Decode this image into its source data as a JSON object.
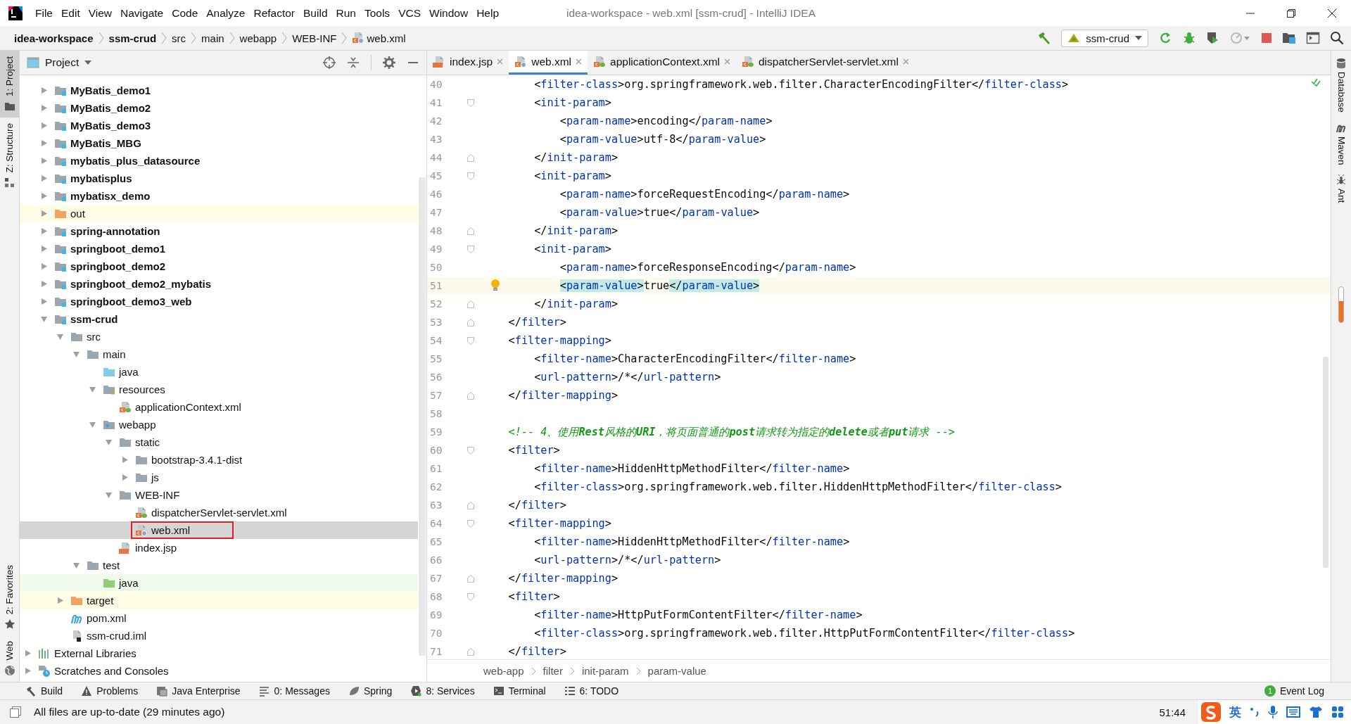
{
  "window": {
    "title": "idea-workspace - web.xml [ssm-crud] - IntelliJ IDEA"
  },
  "menu": [
    "File",
    "Edit",
    "View",
    "Navigate",
    "Code",
    "Analyze",
    "Refactor",
    "Build",
    "Run",
    "Tools",
    "VCS",
    "Window",
    "Help"
  ],
  "breadcrumbs": [
    {
      "label": "idea-workspace",
      "kind": "module"
    },
    {
      "label": "ssm-crud",
      "kind": "module"
    },
    {
      "label": "src",
      "kind": "folder"
    },
    {
      "label": "main",
      "kind": "folder"
    },
    {
      "label": "webapp",
      "kind": "folder"
    },
    {
      "label": "WEB-INF",
      "kind": "folder"
    },
    {
      "label": "web.xml",
      "kind": "file"
    }
  ],
  "run_config": {
    "label": "ssm-crud"
  },
  "left_tool_tabs": [
    {
      "label": "1: Project",
      "kind": "project",
      "selected": true
    },
    {
      "label": "Z: Structure",
      "kind": "structure",
      "selected": false
    }
  ],
  "left_tool_tabs_bottom": [
    {
      "label": "2: Favorites",
      "kind": "favorites",
      "selected": false
    },
    {
      "label": "Web",
      "kind": "web",
      "selected": false
    }
  ],
  "right_tool_tabs": [
    {
      "label": "Database",
      "kind": "database"
    },
    {
      "label": "Maven",
      "kind": "maven"
    },
    {
      "label": "Ant",
      "kind": "ant"
    }
  ],
  "project": {
    "title": "Project",
    "tree": {
      "project_items": [
        {
          "label": "MyBatis_demo1",
          "kind": "module",
          "expanded": false,
          "selected": false
        },
        {
          "label": "MyBatis_demo2",
          "kind": "module",
          "expanded": false,
          "selected": false
        },
        {
          "label": "MyBatis_demo3",
          "kind": "module",
          "expanded": false,
          "selected": false
        },
        {
          "label": "MyBatis_MBG",
          "kind": "module",
          "expanded": false,
          "selected": false
        },
        {
          "label": "mybatis_plus_datasource",
          "kind": "module",
          "expanded": false,
          "selected": false
        },
        {
          "label": "mybatisplus",
          "kind": "module",
          "expanded": false,
          "selected": false
        },
        {
          "label": "mybatisx_demo",
          "kind": "module",
          "expanded": false,
          "selected": false
        },
        {
          "label": "out",
          "kind": "excluded",
          "expanded": false,
          "selected": false
        },
        {
          "label": "spring-annotation",
          "kind": "module",
          "expanded": false,
          "selected": false
        },
        {
          "label": "springboot_demo1",
          "kind": "module",
          "expanded": false,
          "selected": false
        },
        {
          "label": "springboot_demo2",
          "kind": "module",
          "expanded": false,
          "selected": false
        },
        {
          "label": "springboot_demo2_mybatis",
          "kind": "module",
          "expanded": false,
          "selected": false
        },
        {
          "label": "springboot_demo3_web",
          "kind": "module",
          "expanded": false,
          "selected": false
        },
        {
          "label": "ssm-crud",
          "kind": "module",
          "expanded": true,
          "selected": false,
          "children": [
            {
              "label": "src",
              "kind": "folder",
              "expanded": true,
              "selected": false,
              "children": [
                {
                  "label": "main",
                  "kind": "folder",
                  "expanded": true,
                  "selected": false,
                  "children": [
                    {
                      "label": "java",
                      "kind": "source",
                      "selected": false
                    },
                    {
                      "label": "resources",
                      "kind": "resources",
                      "expanded": true,
                      "selected": false,
                      "children": [
                        {
                          "label": "applicationContext.xml",
                          "kind": "spring-xml",
                          "selected": false
                        }
                      ]
                    },
                    {
                      "label": "webapp",
                      "kind": "web",
                      "expanded": true,
                      "selected": false,
                      "children": [
                        {
                          "label": "static",
                          "kind": "folder",
                          "expanded": true,
                          "selected": false,
                          "children": [
                            {
                              "label": "bootstrap-3.4.1-dist",
                              "kind": "folder",
                              "expanded": false,
                              "selected": false
                            },
                            {
                              "label": "js",
                              "kind": "folder",
                              "expanded": false,
                              "selected": false
                            }
                          ]
                        },
                        {
                          "label": "WEB-INF",
                          "kind": "folder",
                          "expanded": true,
                          "selected": false,
                          "children": [
                            {
                              "label": "dispatcherServlet-servlet.xml",
                              "kind": "spring-xml",
                              "selected": false
                            },
                            {
                              "label": "web.xml",
                              "kind": "web-xml",
                              "selected": true
                            }
                          ]
                        },
                        {
                          "label": "index.jsp",
                          "kind": "jsp",
                          "selected": false
                        }
                      ]
                    }
                  ]
                },
                {
                  "label": "test",
                  "kind": "folder",
                  "expanded": true,
                  "selected": false,
                  "children": [
                    {
                      "label": "java",
                      "kind": "test-source",
                      "selected": false
                    }
                  ]
                }
              ]
            },
            {
              "label": "target",
              "kind": "excluded",
              "expanded": false,
              "selected": false
            },
            {
              "label": "pom.xml",
              "kind": "maven",
              "selected": false
            },
            {
              "label": "ssm-crud.iml",
              "kind": "iml",
              "selected": false
            }
          ]
        }
      ],
      "root_items": [
        {
          "label": "External Libraries",
          "kind": "libraries",
          "expanded": false,
          "selected": false
        },
        {
          "label": "Scratches and Consoles",
          "kind": "scratches",
          "expanded": false,
          "selected": false
        }
      ]
    }
  },
  "editor_tabs": [
    {
      "label": "index.jsp",
      "kind": "jsp",
      "selected": false
    },
    {
      "label": "web.xml",
      "kind": "web-xml",
      "selected": true
    },
    {
      "label": "applicationContext.xml",
      "kind": "spring-xml",
      "selected": false
    },
    {
      "label": "dispatcherServlet-servlet.xml",
      "kind": "spring-xml",
      "selected": false
    }
  ],
  "editor": {
    "lines": [
      {
        "number": "40",
        "code": "        <filter-class>org.springframework.web.filter.CharacterEncodingFilter</filter-class>"
      },
      {
        "number": "41",
        "code": "        <init-param>",
        "fold_start": true
      },
      {
        "number": "42",
        "code": "            <param-name>encoding</param-name>"
      },
      {
        "number": "43",
        "code": "            <param-value>utf-8</param-value>"
      },
      {
        "number": "44",
        "code": "        </init-param>",
        "fold_end": true
      },
      {
        "number": "45",
        "code": "        <init-param>",
        "fold_start": true
      },
      {
        "number": "46",
        "code": "            <param-name>forceRequestEncoding</param-name>"
      },
      {
        "number": "47",
        "code": "            <param-value>true</param-value>"
      },
      {
        "number": "48",
        "code": "        </init-param>",
        "fold_end": true
      },
      {
        "number": "49",
        "code": "        <init-param>",
        "fold_start": true
      },
      {
        "number": "50",
        "code": "            <param-name>forceResponseEncoding</param-name>"
      },
      {
        "number": "51",
        "code": "            <param-value>true</param-value>",
        "current": true
      },
      {
        "number": "52",
        "code": "        </init-param>",
        "fold_end": true
      },
      {
        "number": "53",
        "code": "    </filter>",
        "fold_end": true
      },
      {
        "number": "54",
        "code": "    <filter-mapping>",
        "fold_start": true
      },
      {
        "number": "55",
        "code": "        <filter-name>CharacterEncodingFilter</filter-name>"
      },
      {
        "number": "56",
        "code": "        <url-pattern>/*</url-pattern>"
      },
      {
        "number": "57",
        "code": "    </filter-mapping>",
        "fold_end": true
      },
      {
        "number": "58"
      },
      {
        "number": "59",
        "kind": "comment",
        "code": "    <!-- 4、使用**Rest**风格的**URI**，将页面普通的**post**请求转为指定的**delete**或者**put**请求 -->"
      },
      {
        "number": "60",
        "code": "    <filter>",
        "fold_start": true
      },
      {
        "number": "61",
        "code": "        <filter-name>HiddenHttpMethodFilter</filter-name>"
      },
      {
        "number": "62",
        "code": "        <filter-class>org.springframework.web.filter.HiddenHttpMethodFilter</filter-class>"
      },
      {
        "number": "63",
        "code": "    </filter>",
        "fold_end": true
      },
      {
        "number": "64",
        "code": "    <filter-mapping>",
        "fold_start": true
      },
      {
        "number": "65",
        "code": "        <filter-name>HiddenHttpMethodFilter</filter-name>"
      },
      {
        "number": "66",
        "code": "        <url-pattern>/*</url-pattern>"
      },
      {
        "number": "67",
        "code": "    </filter-mapping>",
        "fold_end": true
      },
      {
        "number": "68",
        "code": "    <filter>",
        "fold_start": true
      },
      {
        "number": "69",
        "code": "        <filter-name>HttpPutFormContentFilter</filter-name>"
      },
      {
        "number": "70",
        "code": "        <filter-class>org.springframework.web.filter.HttpPutFormContentFilter</filter-class>"
      },
      {
        "number": "71",
        "code": "    </filter>",
        "fold_end": true
      }
    ],
    "breadcrumbs": [
      "web-app",
      "filter",
      "init-param",
      "param-value"
    ]
  },
  "bottom_tools": [
    {
      "label": "Build",
      "kind": "build"
    },
    {
      "label": "Problems",
      "kind": "problems"
    },
    {
      "label": "Java Enterprise",
      "kind": "enterprise"
    },
    {
      "label": "0: Messages",
      "kind": "messages"
    },
    {
      "label": "Spring",
      "kind": "spring"
    },
    {
      "label": "8: Services",
      "kind": "services"
    },
    {
      "label": "Terminal",
      "kind": "terminal"
    },
    {
      "label": "6: TODO",
      "kind": "todo"
    }
  ],
  "event_log": {
    "label": "Event Log",
    "badge": "1"
  },
  "status": {
    "message": "All files are up-to-date (29 minutes ago)",
    "position": "51:44"
  },
  "ime": {
    "label": "英"
  }
}
